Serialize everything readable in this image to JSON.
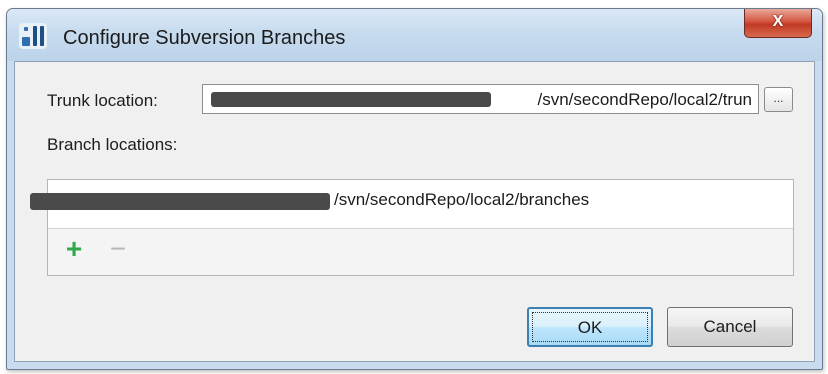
{
  "window": {
    "title": "Configure Subversion Branches",
    "close_label": "X"
  },
  "trunk": {
    "label": "Trunk location:",
    "value": "/svn/secondRepo/local2/trun",
    "browse_label": "..."
  },
  "branches": {
    "label": "Branch locations:",
    "items": [
      {
        "value": "/svn/secondRepo/local2/branches"
      }
    ],
    "add_label": "+",
    "remove_label": "−"
  },
  "buttons": {
    "ok": "OK",
    "cancel": "Cancel"
  },
  "colors": {
    "accent": "#3c7fb1",
    "add_icon": "#2fa84b",
    "remove_icon_disabled": "#b8b8b8"
  }
}
